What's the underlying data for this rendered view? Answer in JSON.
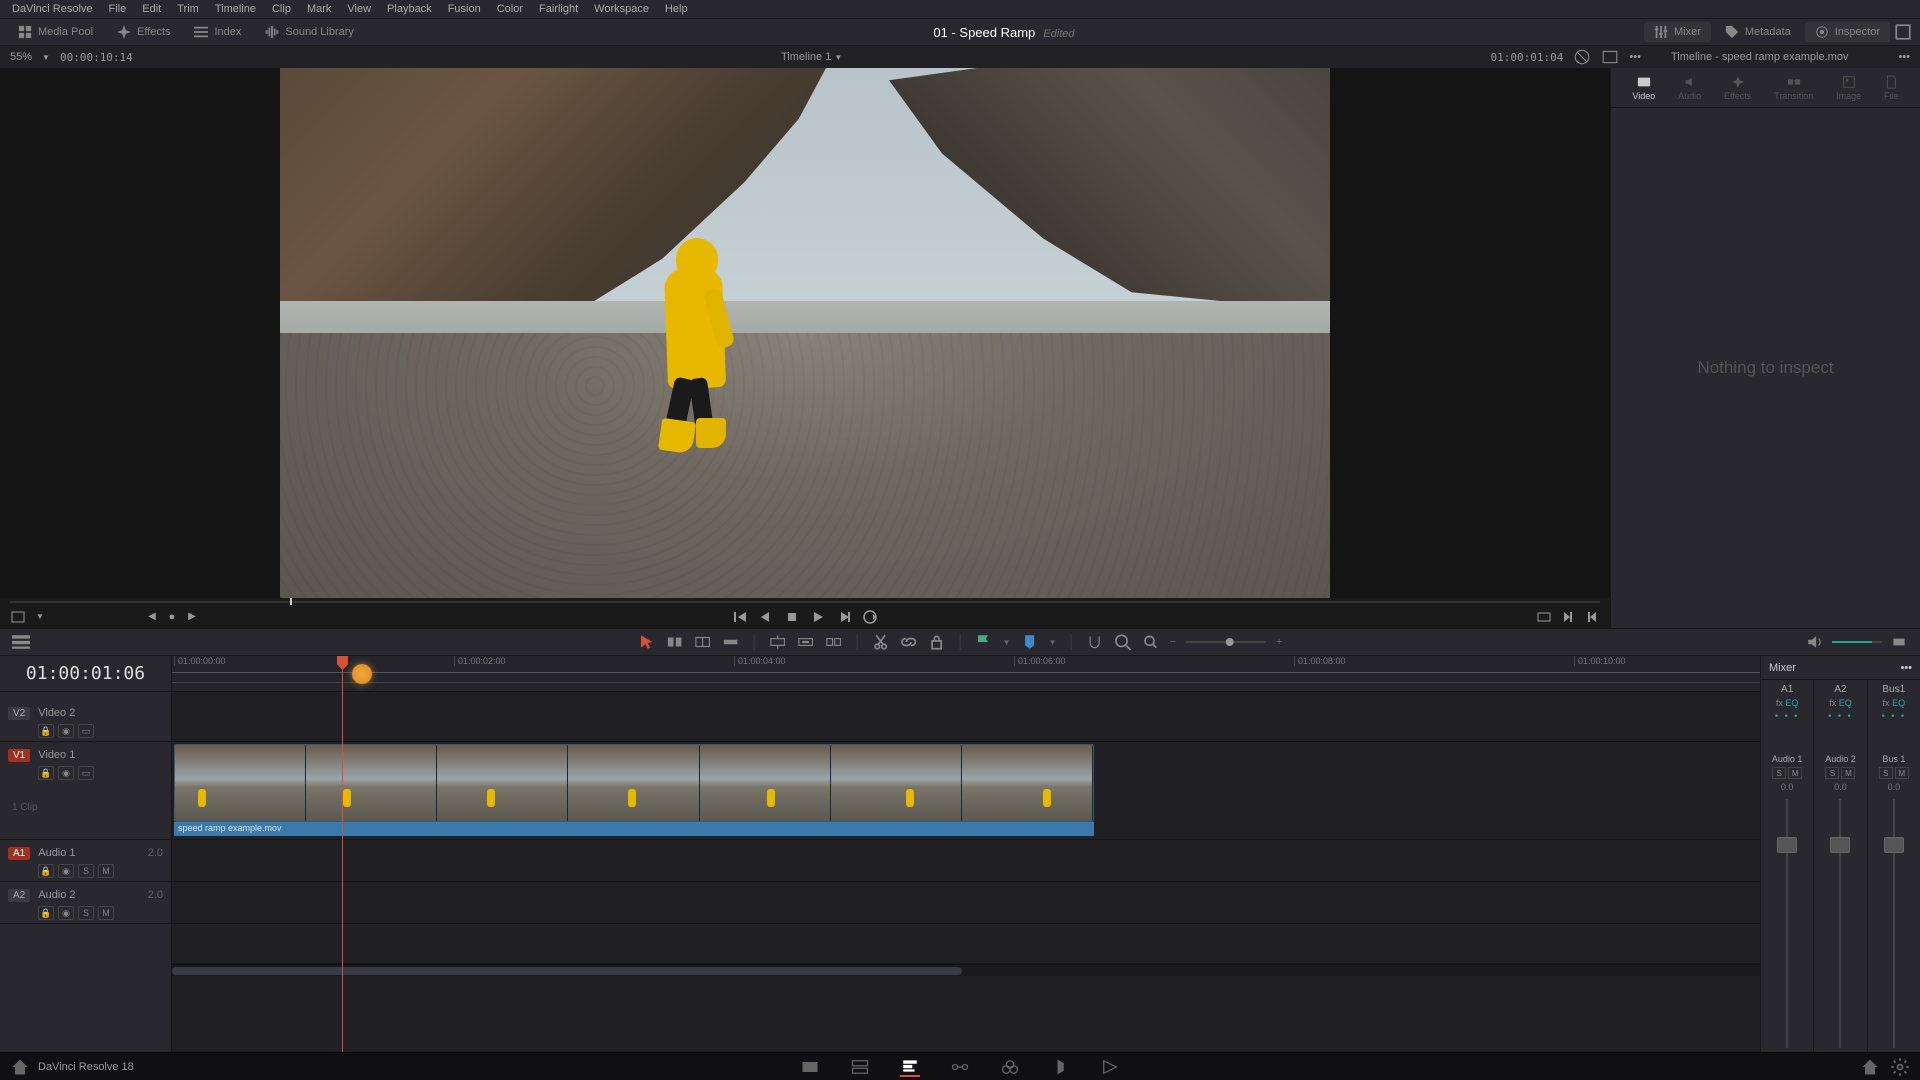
{
  "menubar": [
    "DaVinci Resolve",
    "File",
    "Edit",
    "Trim",
    "Timeline",
    "Clip",
    "Mark",
    "View",
    "Playback",
    "Fusion",
    "Color",
    "Fairlight",
    "Workspace",
    "Help"
  ],
  "topbar": {
    "media_pool": "Media Pool",
    "effects": "Effects",
    "index": "Index",
    "sound": "Sound Library",
    "title": "01 - Speed Ramp",
    "edited": "Edited",
    "mixer": "Mixer",
    "metadata": "Metadata",
    "inspector": "Inspector"
  },
  "subheader": {
    "zoom": "55%",
    "src_tc": "00:00:10:14",
    "timeline_name": "Timeline 1",
    "rec_tc": "01:00:01:04",
    "bin": "Timeline - speed ramp example.mov"
  },
  "inspector": {
    "tabs": [
      "Video",
      "Audio",
      "Effects",
      "Transition",
      "Image",
      "File"
    ],
    "empty": "Nothing to inspect"
  },
  "timeline": {
    "timecode": "01:00:01:06",
    "ruler": [
      "01:00:00:00",
      "01:00:02:00",
      "01:00:04:00",
      "01:00:06:00",
      "01:00:08:00",
      "01:00:10:00"
    ],
    "tracks": {
      "v2": {
        "tag": "V2",
        "name": "Video 2"
      },
      "v1": {
        "tag": "V1",
        "name": "Video 1"
      },
      "a1": {
        "tag": "A1",
        "name": "Audio 1",
        "ch": "2.0"
      },
      "a2": {
        "tag": "A2",
        "name": "Audio 2",
        "ch": "2.0"
      }
    },
    "clip_name": "speed ramp example.mov",
    "one_clip": "1 Clip"
  },
  "mixer": {
    "title": "Mixer",
    "channels": [
      {
        "id": "A1",
        "fx": "fx",
        "eq": "EQ",
        "name": "Audio 1",
        "num": "0.0"
      },
      {
        "id": "A2",
        "fx": "fx",
        "eq": "EQ",
        "name": "Audio 2",
        "num": "0.0"
      },
      {
        "id": "Bus1",
        "fx": "fx",
        "eq": "EQ",
        "name": "Bus 1",
        "num": "0.0"
      }
    ]
  },
  "footer": {
    "version": "DaVinci Resolve 18"
  }
}
